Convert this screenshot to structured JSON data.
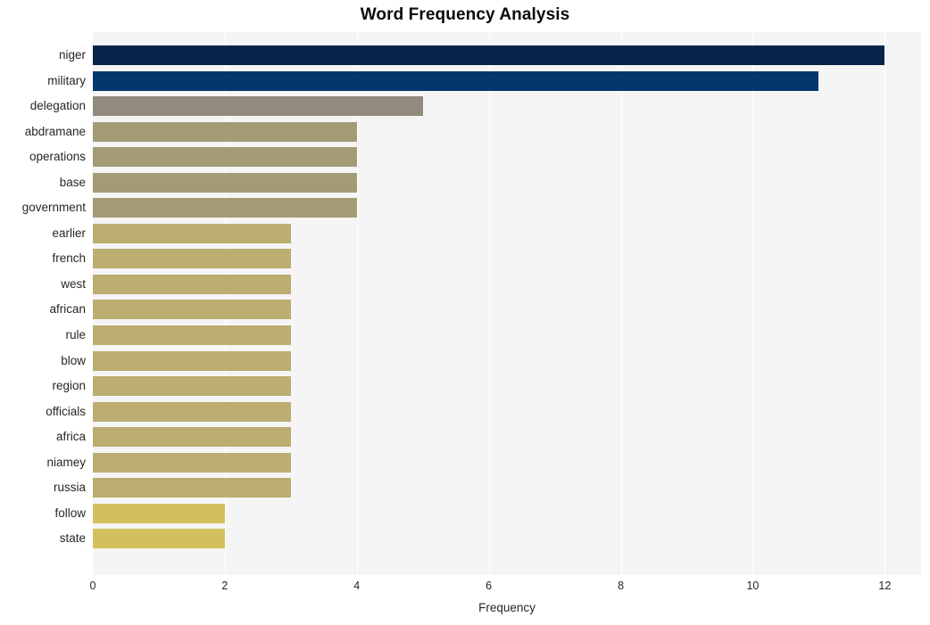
{
  "chart_data": {
    "type": "bar",
    "orientation": "horizontal",
    "title": "Word Frequency Analysis",
    "xlabel": "Frequency",
    "ylabel": "",
    "xlim": [
      0,
      12.55
    ],
    "xticks": [
      0,
      2,
      4,
      6,
      8,
      10,
      12
    ],
    "xtick_labels": [
      "0",
      "2",
      "4",
      "6",
      "8",
      "10",
      "12"
    ],
    "grid": "vertical-white-gridlines",
    "legend": "none",
    "plot_background": "#f5f5f5",
    "figure_background": "#ffffff",
    "categories": [
      "niger",
      "military",
      "delegation",
      "abdramane",
      "operations",
      "base",
      "government",
      "earlier",
      "french",
      "west",
      "african",
      "rule",
      "blow",
      "region",
      "officials",
      "africa",
      "niamey",
      "russia",
      "follow",
      "state"
    ],
    "values": [
      12,
      11,
      5,
      4,
      4,
      4,
      4,
      3,
      3,
      3,
      3,
      3,
      3,
      3,
      3,
      3,
      3,
      3,
      2,
      2
    ],
    "bar_colors": [
      "#07244a",
      "#05376e",
      "#908b7d",
      "#a39b76",
      "#a39b76",
      "#a39b76",
      "#a39b76",
      "#bcad71",
      "#bcad71",
      "#bcad71",
      "#bcad71",
      "#bcad71",
      "#bcad71",
      "#bcad71",
      "#bcad71",
      "#bcad71",
      "#bcad71",
      "#bcad71",
      "#d2c05c",
      "#d2c05c"
    ]
  }
}
